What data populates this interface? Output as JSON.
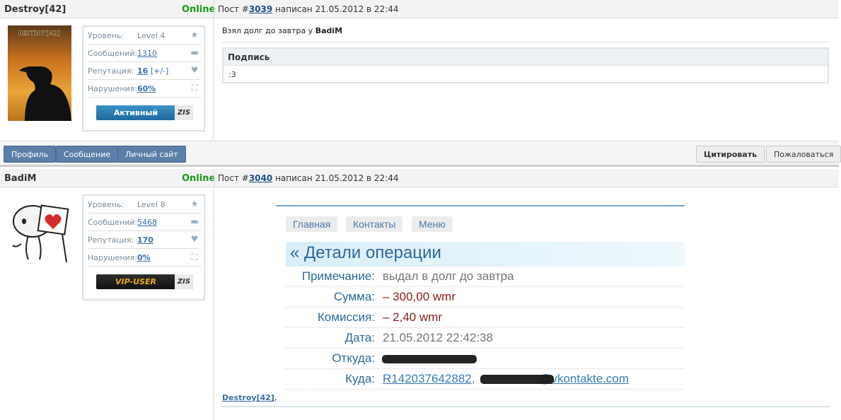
{
  "posts": [
    {
      "author": "Destroy[42]",
      "status": "Online",
      "meta_prefix": "Пост #",
      "post_number": "3039",
      "meta_suffix": "написан 21.05.2012 в 22:44",
      "avatar_text": "DESTROY[42]",
      "info": {
        "level_label": "Уровень:",
        "level_value": "Level 4",
        "messages_label": "Сообщений:",
        "messages_value": "1310",
        "rep_label": "Репутация:",
        "rep_value": "16",
        "rep_extra": "[+/-]",
        "viol_label": "Нарушения:",
        "viol_value": "60%"
      },
      "badge": {
        "label": "Активный",
        "tag": "ZIS"
      },
      "body_text_prefix": "Взял долг до завтра у ",
      "body_text_name": "BadiM",
      "signature_title": "Подпись",
      "signature_text": ":3"
    },
    {
      "author": "BadiM",
      "status": "Online",
      "meta_prefix": "Пост #",
      "post_number": "3040",
      "meta_suffix": "написан 21.05.2012 в 22:44",
      "info": {
        "level_label": "Уровень:",
        "level_value": "Level 8",
        "messages_label": "Сообщений:",
        "messages_value": "5468",
        "rep_label": "Репутация:",
        "rep_value": "170",
        "viol_label": "Нарушения:",
        "viol_value": "0%"
      },
      "badge": {
        "label": "VIP-USER",
        "tag": "ZIS"
      },
      "reply_name": "Destroy[42]",
      "reply_suffix": ","
    }
  ],
  "buttons": {
    "profile": "Профиль",
    "message": "Сообщение",
    "website": "Личный сайт",
    "quote": "Цитировать",
    "report": "Пожаловаться"
  },
  "operation": {
    "nav": [
      "Главная",
      "Контакты",
      "Меню"
    ],
    "title": "« Детали операции",
    "rows": [
      {
        "key": "Примечание:",
        "value": "выдал в долг до завтра"
      },
      {
        "key": "Сумма:",
        "value": "– 300,00 wmr"
      },
      {
        "key": "Комиссия:",
        "value": "– 2,40 wmr"
      },
      {
        "key": "Дата:",
        "value": "21.05.2012 22:42:38"
      },
      {
        "key": "Откуда:",
        "value": ""
      },
      {
        "key": "Куда:",
        "value": "R142037642882",
        "value_sep": ", ",
        "value2": "@vkontakte.com"
      }
    ]
  },
  "colors": {
    "online": "#1a9a1a",
    "link": "#1f4f8a",
    "button_blue": "#5b7fa8",
    "badge_active": "#2a7ab0",
    "badge_vip": "#222222",
    "op_title": "#2c6a99"
  }
}
